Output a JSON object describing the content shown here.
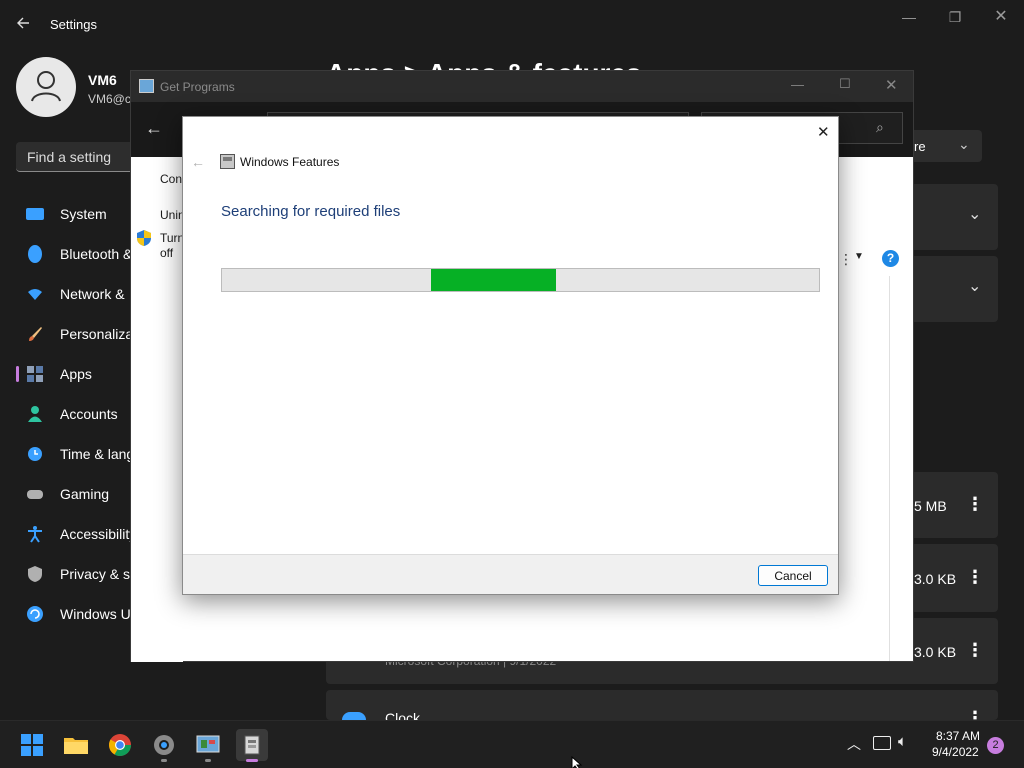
{
  "settings": {
    "title": "Settings",
    "user_name": "VM6",
    "user_email": "VM6@c",
    "search_placeholder": "Find a setting",
    "page_heading": "Apps > Apps & features",
    "nav": [
      {
        "label": "System",
        "icon": "system-icon",
        "color": "#3aa0ff"
      },
      {
        "label": "Bluetooth &",
        "icon": "bluetooth-icon",
        "color": "#3aa0ff"
      },
      {
        "label": "Network &",
        "icon": "wifi-icon",
        "color": "#3aa0ff"
      },
      {
        "label": "Personaliza",
        "icon": "brush-icon",
        "color": "#e8a060"
      },
      {
        "label": "Apps",
        "icon": "apps-icon",
        "color": "#8fa0b8"
      },
      {
        "label": "Accounts",
        "icon": "person-icon",
        "color": "#2ec4a0"
      },
      {
        "label": "Time & lang",
        "icon": "clock-globe-icon",
        "color": "#3aa0ff"
      },
      {
        "label": "Gaming",
        "icon": "gamepad-icon",
        "color": "#b0b0b0"
      },
      {
        "label": "Accessibility",
        "icon": "accessibility-icon",
        "color": "#3aa0ff"
      },
      {
        "label": "Privacy & se",
        "icon": "shield-icon",
        "color": "#b0b0b0"
      },
      {
        "label": "Windows U",
        "icon": "update-icon",
        "color": "#3aa0ff"
      }
    ],
    "more_button": "re",
    "app_sizes": [
      "5 MB",
      "3.0 KB",
      "3.0 KB"
    ],
    "app_publisher": "Microsoft Corporation  |  9/1/2022",
    "app_last": "Clock"
  },
  "get_programs": {
    "title": "Get Programs",
    "side_links": [
      "Cont",
      "Unin",
      "Turn",
      "off"
    ]
  },
  "dialog": {
    "title": "Windows Features",
    "heading": "Searching for required files",
    "progress_fraction": 0.21,
    "progress_width_fraction": 0.21,
    "cancel": "Cancel",
    "accent": "#06b025"
  },
  "taskbar": {
    "time": "8:37 AM",
    "date": "9/4/2022",
    "notification_count": "2"
  }
}
